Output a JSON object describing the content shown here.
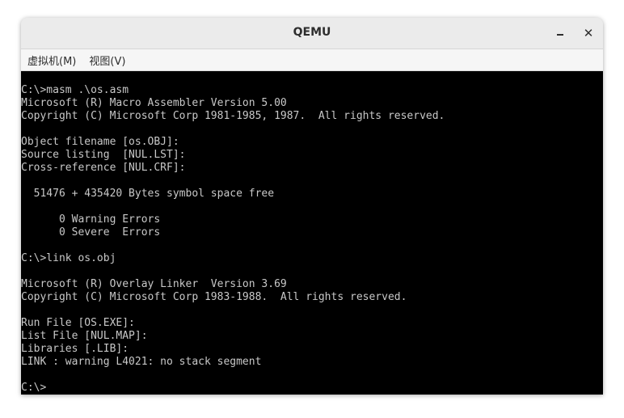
{
  "window": {
    "title": "QEMU",
    "minimize_label": "",
    "close_label": "✕"
  },
  "menu": {
    "items": [
      {
        "label": "虚拟机(M)"
      },
      {
        "label": "视图(V)"
      }
    ]
  },
  "terminal": {
    "lines": [
      "C:\\>masm .\\os.asm",
      "Microsoft (R) Macro Assembler Version 5.00",
      "Copyright (C) Microsoft Corp 1981-1985, 1987.  All rights reserved.",
      "",
      "Object filename [os.OBJ]:",
      "Source listing  [NUL.LST]:",
      "Cross-reference [NUL.CRF]:",
      "",
      "  51476 + 435420 Bytes symbol space free",
      "",
      "      0 Warning Errors",
      "      0 Severe  Errors",
      "",
      "C:\\>link os.obj",
      "",
      "Microsoft (R) Overlay Linker  Version 3.69",
      "Copyright (C) Microsoft Corp 1983-1988.  All rights reserved.",
      "",
      "Run File [OS.EXE]:",
      "List File [NUL.MAP]:",
      "Libraries [.LIB]:",
      "LINK : warning L4021: no stack segment",
      "",
      "C:\\>"
    ]
  }
}
